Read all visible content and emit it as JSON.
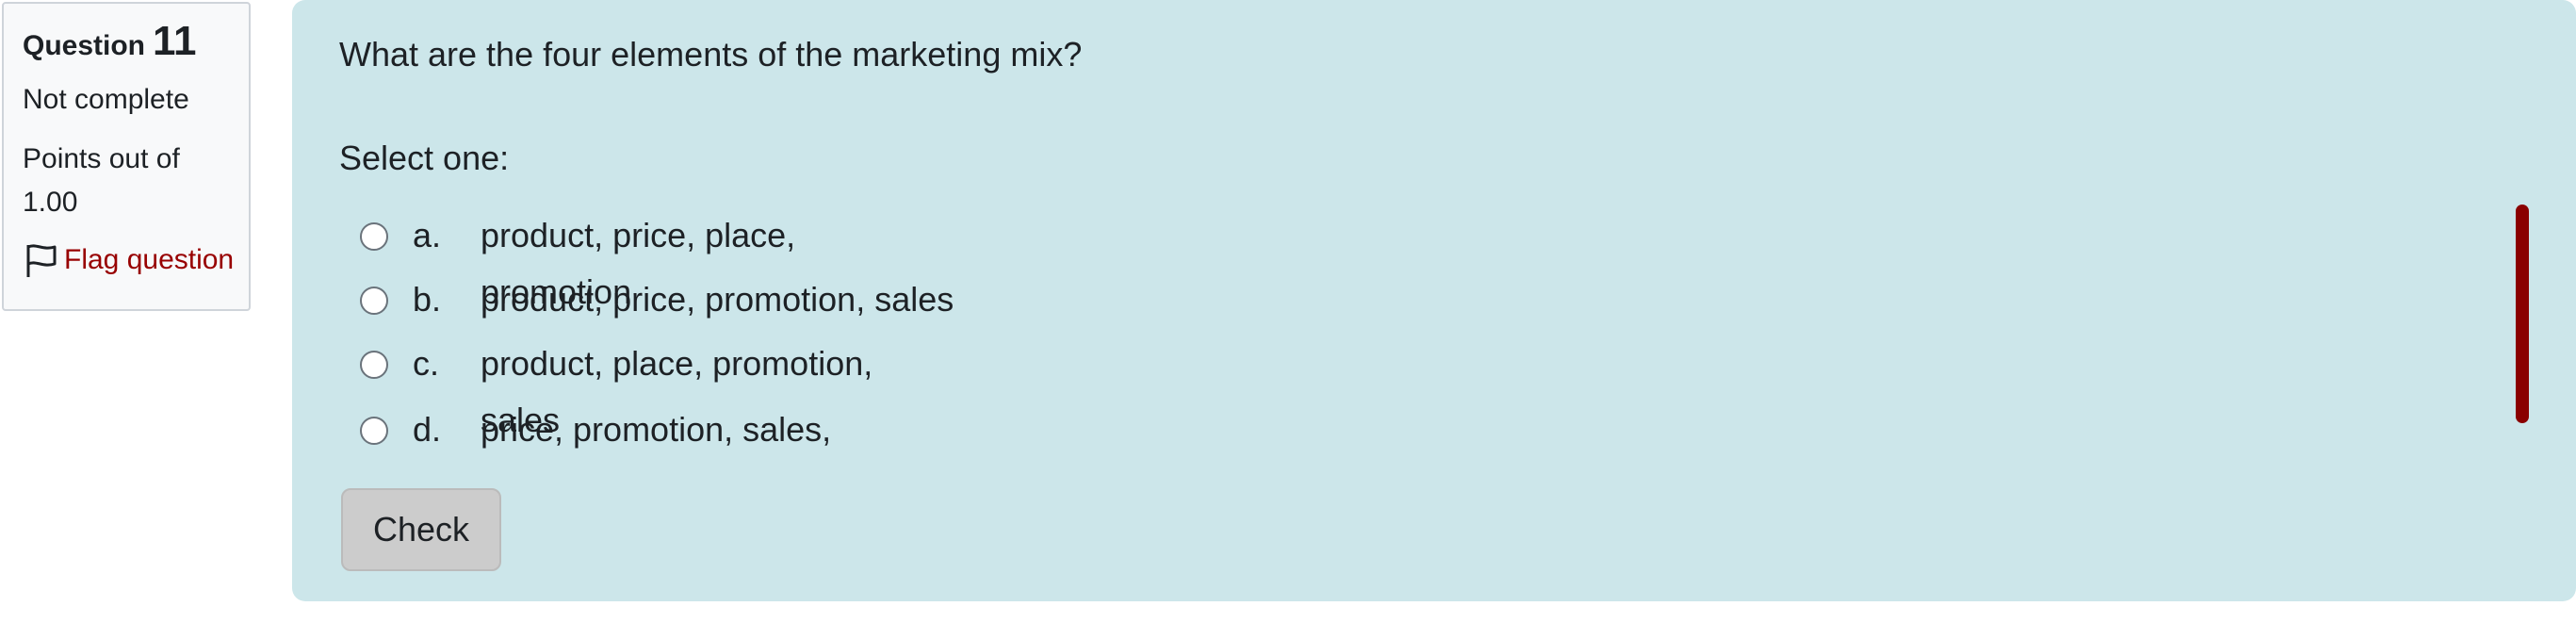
{
  "question_info": {
    "label": "Question",
    "number": "11",
    "state": "Not complete",
    "grade": "Points out of 1.00",
    "flag_label": "Flag question",
    "flag_icon": "flag-outline-icon"
  },
  "question": {
    "text": "What are the four elements of the marketing mix?",
    "prompt": "Select one:",
    "options": [
      {
        "letter": "a.",
        "text": "product, price, place, promotion",
        "selected": false
      },
      {
        "letter": "b.",
        "text": "product, price, promotion, sales",
        "selected": false
      },
      {
        "letter": "c.",
        "text": "product, place, promotion, sales",
        "selected": false
      },
      {
        "letter": "d.",
        "text": "price, promotion, sales,",
        "selected": false
      }
    ],
    "check_label": "Check"
  },
  "colors": {
    "content_bg": "#cce6ea",
    "info_bg": "#f8f9fa",
    "flag_text": "#980000",
    "scrollbar": "#8a0000",
    "check_button": "#cccccc"
  }
}
